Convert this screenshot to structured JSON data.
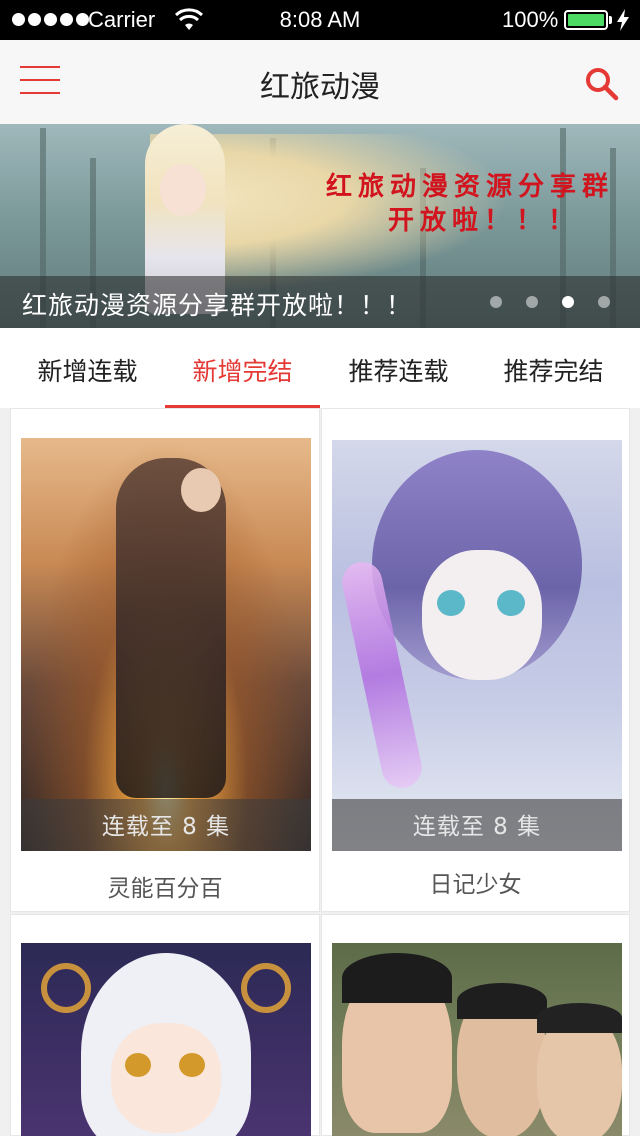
{
  "status_bar": {
    "carrier": "Carrier",
    "time": "8:08 AM",
    "battery": "100%",
    "battery_color": "#4cd964"
  },
  "nav": {
    "title": "红旅动漫",
    "menu_icon": "hamburger-menu-icon",
    "search_icon": "search-icon",
    "accent": "#e53935"
  },
  "banner": {
    "promo_line1": "红旅动漫资源分享群",
    "promo_line2": "开放啦！！！",
    "caption": "红旅动漫资源分享群开放啦！！！",
    "page_count": 4,
    "active_page": 3
  },
  "tabs": [
    {
      "label": "新增连载",
      "active": false
    },
    {
      "label": "新增完结",
      "active": true
    },
    {
      "label": "推荐连载",
      "active": false
    },
    {
      "label": "推荐完结",
      "active": false
    }
  ],
  "cards": [
    {
      "progress": "连载至 8 集",
      "title": "灵能百分百"
    },
    {
      "progress": "连载至 8 集",
      "title": "日记少女"
    },
    {
      "progress": "",
      "title": ""
    },
    {
      "progress": "",
      "title": ""
    }
  ]
}
